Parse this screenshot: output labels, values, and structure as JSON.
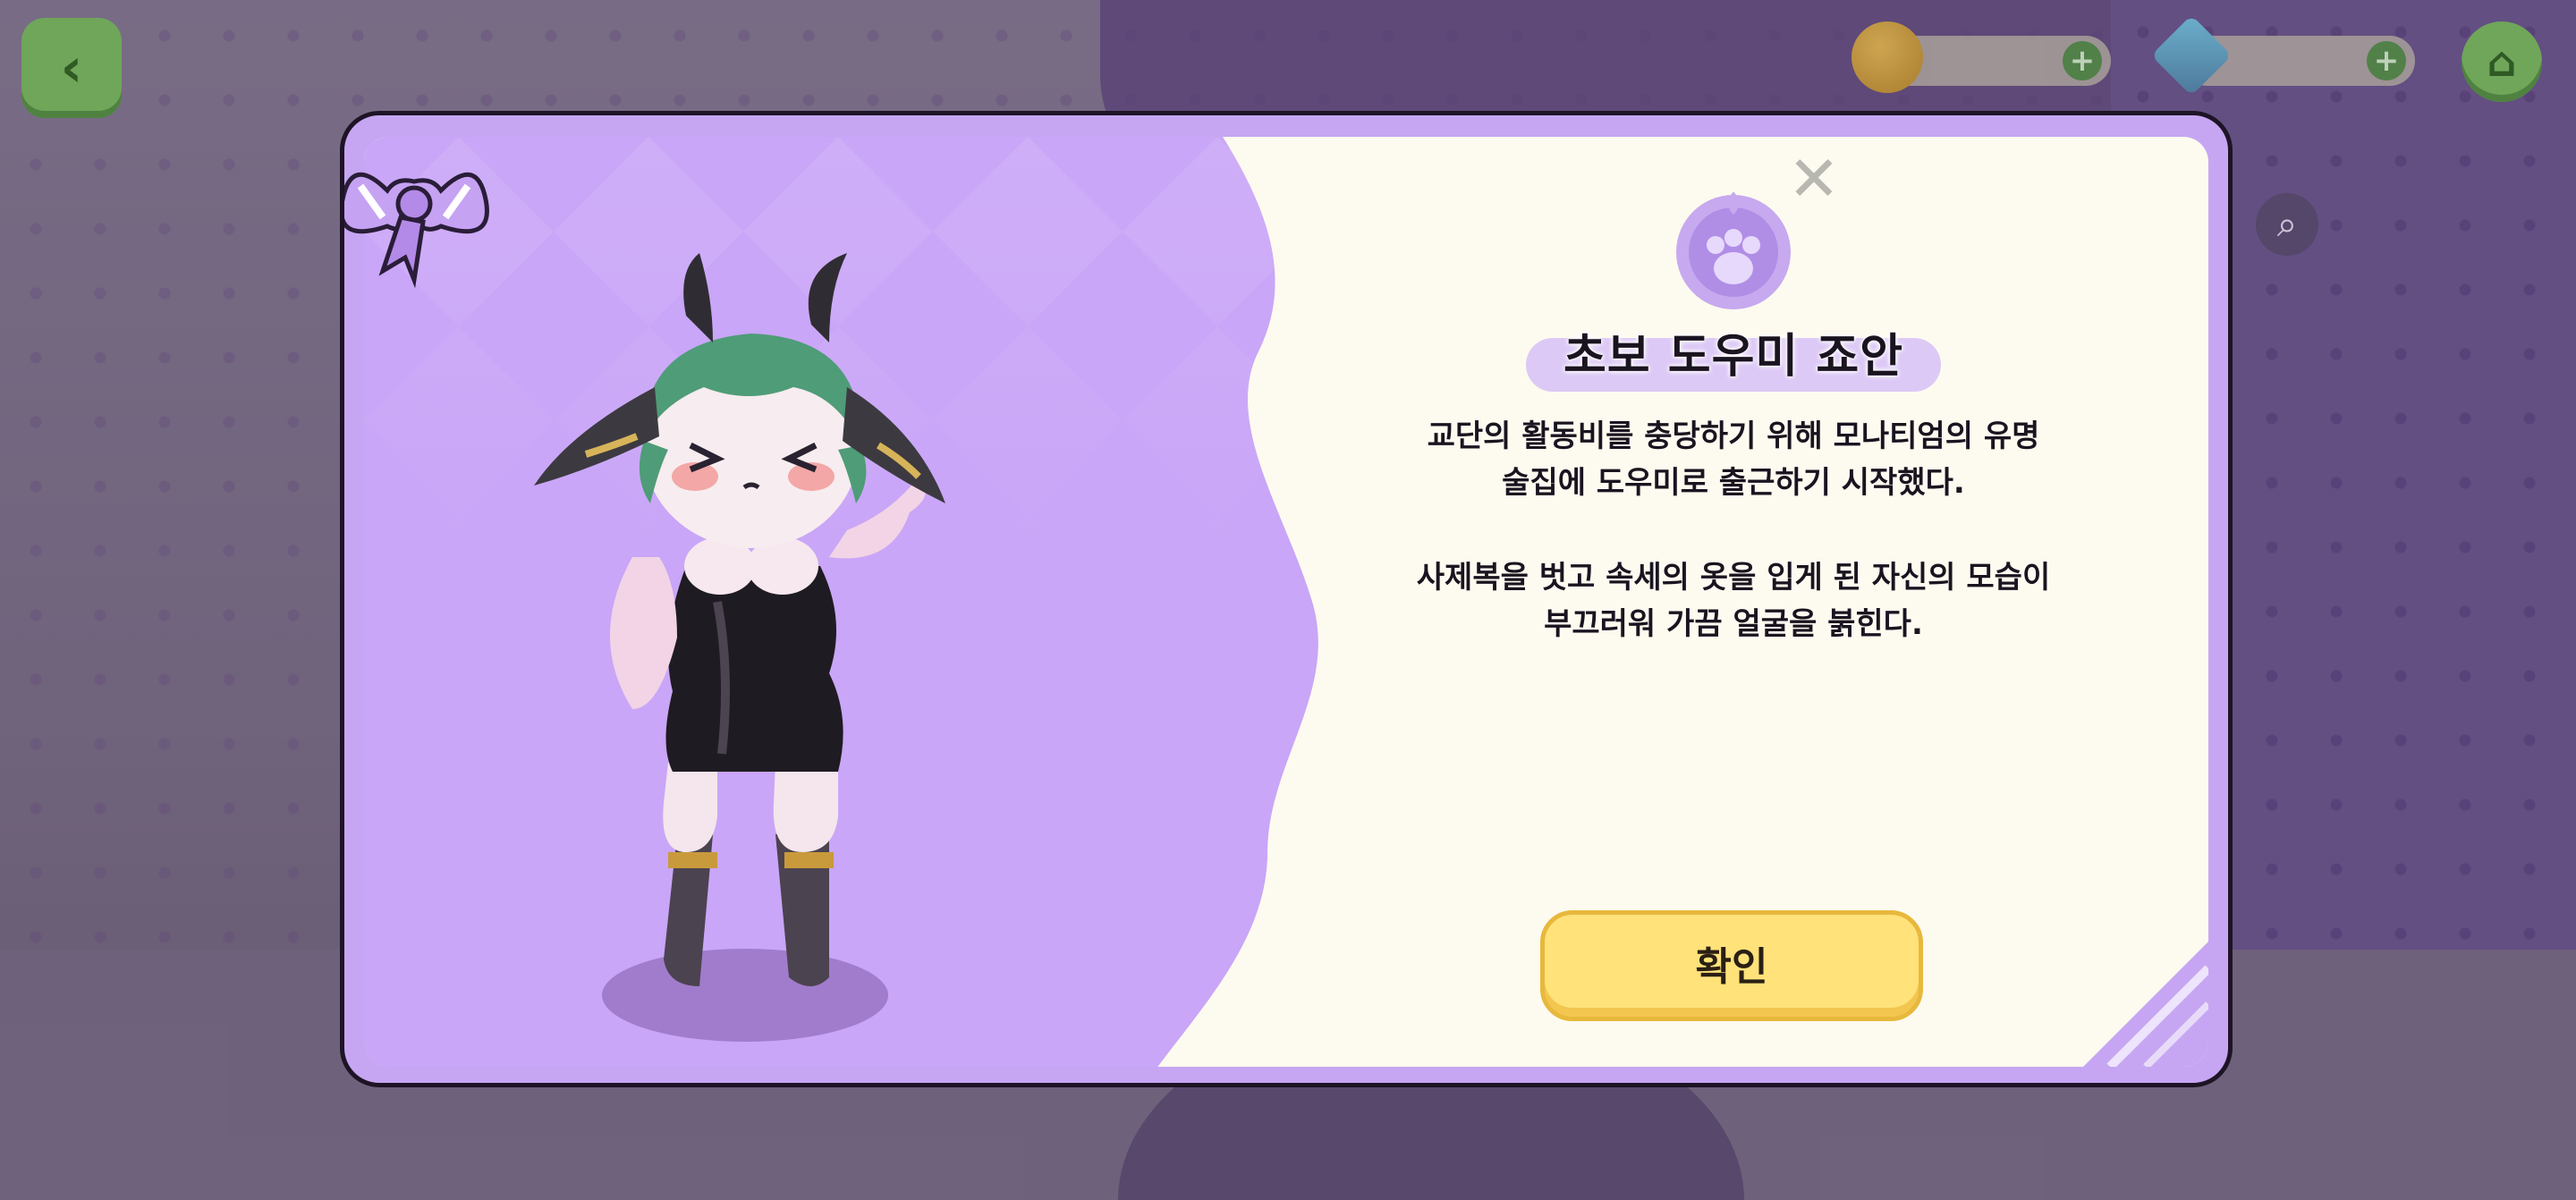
{
  "hud": {
    "back_icon": "chevron-left-icon",
    "home_icon": "home-icon",
    "coin_icon": "gold-coin-icon",
    "gem_icon": "gem-icon",
    "plus_label": "+",
    "search_icon": "magnifier-icon"
  },
  "modal": {
    "title": "초보 도우미 죠안",
    "description_1": "교단의 활동비를 충당하기 위해 모나티엄의 유명\n술집에 도우미로 출근하기 시작했다.",
    "description_2": "사제복을 벗고 속세의 옷을 입게 된 자신의 모습이\n부끄러워 가끔 얼굴을 붉힌다.",
    "confirm_label": "확인",
    "close_icon": "close-icon",
    "close_glyph": "✕",
    "emblem_icon": "paw-crest-icon",
    "character_image": "character-illustration",
    "ribbon_icon": "ribbon-bow-icon"
  },
  "colors": {
    "panel_purple": "#c6a6f2",
    "art_purple": "#c9a6f7",
    "cream": "#fdfbf0",
    "button_yellow": "#ffe27a",
    "hud_green": "#6fa65a"
  }
}
